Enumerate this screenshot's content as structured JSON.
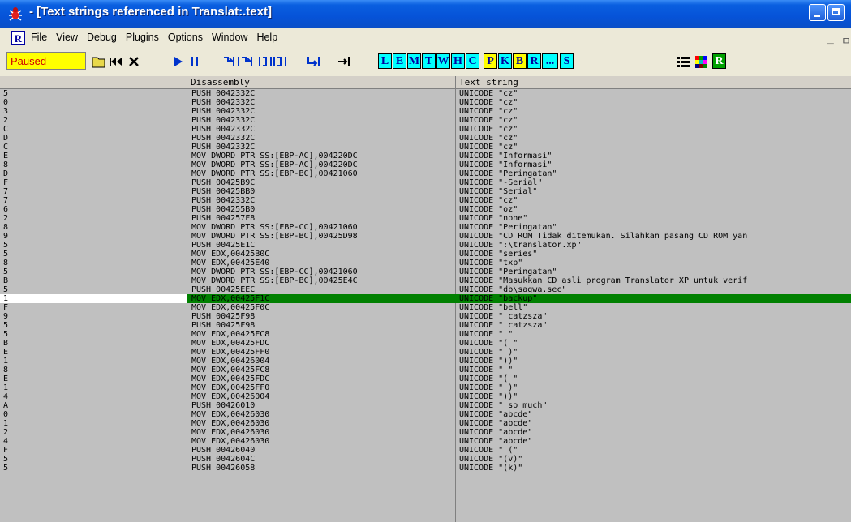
{
  "window": {
    "title": "- [Text strings referenced in Translat:.text]"
  },
  "menu": {
    "icon_letter": "R",
    "items": [
      "File",
      "View",
      "Debug",
      "Plugins",
      "Options",
      "Window",
      "Help"
    ],
    "mdi_controls": [
      "_",
      "ㅁ"
    ]
  },
  "toolbar": {
    "status": "Paused",
    "letter_buttons": [
      "L",
      "E",
      "M",
      "T",
      "W",
      "H",
      "C",
      "P",
      "K",
      "B",
      "R",
      "...",
      "S"
    ],
    "highlighted_letters": [
      "P",
      "B"
    ]
  },
  "table": {
    "headers": [
      "",
      "Disassembly",
      "Text string"
    ],
    "selected_index": 23,
    "rows": [
      {
        "addr": "5",
        "dis": "PUSH 0042332C",
        "text": "UNICODE \"cz\""
      },
      {
        "addr": "0",
        "dis": "PUSH 0042332C",
        "text": "UNICODE \"cz\""
      },
      {
        "addr": "3",
        "dis": "PUSH 0042332C",
        "text": "UNICODE \"cz\""
      },
      {
        "addr": "2",
        "dis": "PUSH 0042332C",
        "text": "UNICODE \"cz\""
      },
      {
        "addr": "C",
        "dis": "PUSH 0042332C",
        "text": "UNICODE \"cz\""
      },
      {
        "addr": "D",
        "dis": "PUSH 0042332C",
        "text": "UNICODE \"cz\""
      },
      {
        "addr": "C",
        "dis": "PUSH 0042332C",
        "text": "UNICODE \"cz\""
      },
      {
        "addr": "E",
        "dis": "MOV DWORD PTR SS:[EBP-AC],004220DC",
        "text": "UNICODE \"Informasi\""
      },
      {
        "addr": "8",
        "dis": "MOV DWORD PTR SS:[EBP-AC],004220DC",
        "text": "UNICODE \"Informasi\""
      },
      {
        "addr": "D",
        "dis": "MOV DWORD PTR SS:[EBP-BC],00421060",
        "text": "UNICODE \"Peringatan\""
      },
      {
        "addr": "F",
        "dis": "PUSH 00425B9C",
        "text": "UNICODE \"-Serial\""
      },
      {
        "addr": "7",
        "dis": "PUSH 00425BB0",
        "text": "UNICODE \"Serial\""
      },
      {
        "addr": "7",
        "dis": "PUSH 0042332C",
        "text": "UNICODE \"cz\""
      },
      {
        "addr": "6",
        "dis": "PUSH 004255B0",
        "text": "UNICODE \"oz\""
      },
      {
        "addr": "2",
        "dis": "PUSH 004257F8",
        "text": "UNICODE \"none\""
      },
      {
        "addr": "8",
        "dis": "MOV DWORD PTR SS:[EBP-CC],00421060",
        "text": "UNICODE \"Peringatan\""
      },
      {
        "addr": "9",
        "dis": "MOV DWORD PTR SS:[EBP-BC],00425D98",
        "text": "UNICODE \"CD ROM Tidak ditemukan. Silahkan pasang CD ROM yan"
      },
      {
        "addr": "5",
        "dis": "PUSH 00425E1C",
        "text": "UNICODE \":\\translator.xp\""
      },
      {
        "addr": "5",
        "dis": "MOV EDX,00425B0C",
        "text": "UNICODE \"series\""
      },
      {
        "addr": "8",
        "dis": "MOV EDX,00425E40",
        "text": "UNICODE \"txp\""
      },
      {
        "addr": "5",
        "dis": "MOV DWORD PTR SS:[EBP-CC],00421060",
        "text": "UNICODE \"Peringatan\""
      },
      {
        "addr": "B",
        "dis": "MOV DWORD PTR SS:[EBP-BC],00425E4C",
        "text": "UNICODE \"Masukkan CD asli program Translator XP untuk verif"
      },
      {
        "addr": "5",
        "dis": "PUSH 00425EEC",
        "text": "UNICODE \"db\\sagwa.sec\""
      },
      {
        "addr": "1",
        "dis": "MOV EDX,00425F1C",
        "text": "UNICODE \"backup\""
      },
      {
        "addr": "F",
        "dis": "MOV EDX,00425F0C",
        "text": "UNICODE \"bell\""
      },
      {
        "addr": "9",
        "dis": "PUSH 00425F98",
        "text": "UNICODE \" catzsza\""
      },
      {
        "addr": "5",
        "dis": "PUSH 00425F98",
        "text": "UNICODE \" catzsza\""
      },
      {
        "addr": "5",
        "dis": "MOV EDX,00425FC8",
        "text": "UNICODE \" \""
      },
      {
        "addr": "B",
        "dis": "MOV EDX,00425FDC",
        "text": "UNICODE \"( \""
      },
      {
        "addr": "E",
        "dis": "MOV EDX,00425FF0",
        "text": "UNICODE \" )\""
      },
      {
        "addr": "1",
        "dis": "MOV EDX,00426004",
        "text": "UNICODE \"))\""
      },
      {
        "addr": "8",
        "dis": "MOV EDX,00425FC8",
        "text": "UNICODE \" \""
      },
      {
        "addr": "E",
        "dis": "MOV EDX,00425FDC",
        "text": "UNICODE \"( \""
      },
      {
        "addr": "1",
        "dis": "MOV EDX,00425FF0",
        "text": "UNICODE \" )\""
      },
      {
        "addr": "4",
        "dis": "MOV EDX,00426004",
        "text": "UNICODE \"))\""
      },
      {
        "addr": "A",
        "dis": "PUSH 00426010",
        "text": "UNICODE \" so much\""
      },
      {
        "addr": "0",
        "dis": "MOV EDX,00426030",
        "text": "UNICODE \"abcde\""
      },
      {
        "addr": "1",
        "dis": "MOV EDX,00426030",
        "text": "UNICODE \"abcde\""
      },
      {
        "addr": "2",
        "dis": "MOV EDX,00426030",
        "text": "UNICODE \"abcde\""
      },
      {
        "addr": "4",
        "dis": "MOV EDX,00426030",
        "text": "UNICODE \"abcde\""
      },
      {
        "addr": "F",
        "dis": "PUSH 00426040",
        "text": "UNICODE \" (\""
      },
      {
        "addr": "5",
        "dis": "PUSH 0042604C",
        "text": "UNICODE \"(v)\""
      },
      {
        "addr": "5",
        "dis": "PUSH 00426058",
        "text": "UNICODE \"(k)\""
      }
    ]
  }
}
